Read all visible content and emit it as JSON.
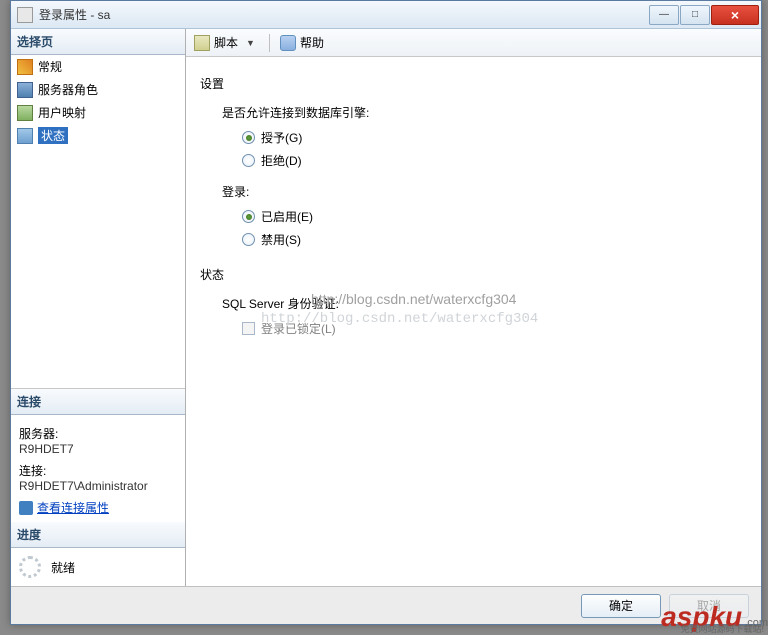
{
  "window": {
    "title": "登录属性 - sa"
  },
  "sidebar": {
    "select_page": "选择页",
    "items": [
      {
        "label": "常规"
      },
      {
        "label": "服务器角色"
      },
      {
        "label": "用户映射"
      },
      {
        "label": "状态"
      }
    ],
    "connection_title": "连接",
    "server_label": "服务器:",
    "server_value": "R9HDET7",
    "conn_label": "连接:",
    "conn_value": "R9HDET7\\Administrator",
    "view_props": "查看连接属性",
    "progress_title": "进度",
    "progress_status": "就绪"
  },
  "toolbar": {
    "script": "脚本",
    "help": "帮助"
  },
  "content": {
    "settings": "设置",
    "allow_connect": "是否允许连接到数据库引擎:",
    "grant": "授予(G)",
    "deny": "拒绝(D)",
    "login": "登录:",
    "enabled": "已启用(E)",
    "disabled": "禁用(S)",
    "status": "状态",
    "sql_auth": "SQL Server 身份验证:",
    "locked": "登录已锁定(L)"
  },
  "watermark": {
    "line1": "http://blog.csdn.net/waterxcfg304",
    "line2": "http://blog.csdn.net/waterxcfg304"
  },
  "footer": {
    "ok": "确定",
    "cancel": "取消"
  },
  "brand": {
    "name": "aspku",
    "tld": ".com",
    "sub": "免费网站源码下载站!"
  }
}
